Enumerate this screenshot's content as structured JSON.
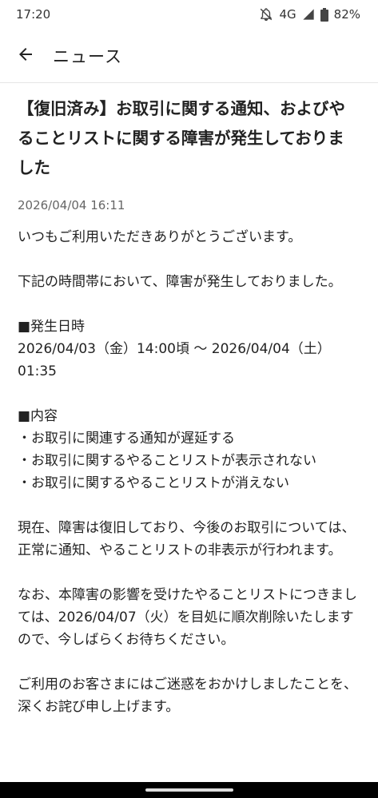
{
  "status_bar": {
    "time": "17:20",
    "network": "4G",
    "battery": "82%",
    "icons": [
      "bell-off-icon",
      "signal-icon",
      "battery-icon"
    ]
  },
  "app_bar": {
    "back_icon": "arrow-left-icon",
    "title": "ニュース"
  },
  "article": {
    "title": "【復旧済み】お取引に関する通知、およびやることリストに関する障害が発生しておりました",
    "date": "2026/04/04 16:11",
    "body": "いつもご利用いただきありがとうございます。\n\n下記の時間帯において、障害が発生しておりました。\n\n■発生日時\n2026/04/03（金）14:00頃 〜 2026/04/04（土）01:35\n\n■内容\n・お取引に関連する通知が遅延する\n・お取引に関するやることリストが表示されない\n・お取引に関するやることリストが消えない\n\n現在、障害は復旧しており、今後のお取引については、正常に通知、やることリストの非表示が行われます。\n\nなお、本障害の影響を受けたやることリストにつきましては、2026/04/07（火）を目処に順次削除いたしますので、今しばらくお待ちください。\n\nご利用のお客さまにはご迷惑をおかけしましたことを、深くお詫び申し上げます。"
  },
  "colors": {
    "text": "#222222",
    "meta": "#666666",
    "divider": "#e6e6e6",
    "nav_bar": "#000000"
  }
}
